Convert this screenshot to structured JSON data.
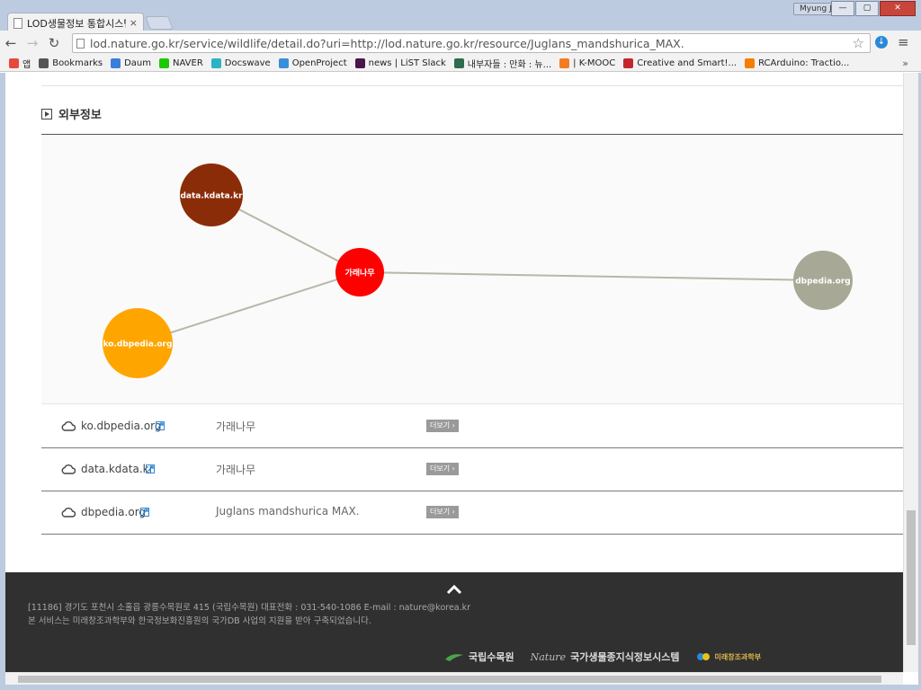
{
  "browser": {
    "tab_title": "LOD생물정보 통합시스템",
    "tab_close": "×",
    "user_name": "Myung Jin",
    "url": "lod.nature.go.kr/service/wildlife/detail.do?uri=http://lod.nature.go.kr/resource/Juglans_mandshurica_MAX.",
    "bookmarks": [
      {
        "label": "앱",
        "color": "#e54a3c"
      },
      {
        "label": "Bookmarks",
        "color": "#555555"
      },
      {
        "label": "Daum",
        "color": "#3b7ddd"
      },
      {
        "label": "NAVER",
        "color": "#1ec800"
      },
      {
        "label": "Docswave",
        "color": "#2bb3c4"
      },
      {
        "label": "OpenProject",
        "color": "#3a8ed8"
      },
      {
        "label": "news | LiST Slack",
        "color": "#4a154b"
      },
      {
        "label": "내부자들 : 만화 : 뉴...",
        "color": "#2e6b4f"
      },
      {
        "label": "| K-MOOC",
        "color": "#f47b20"
      },
      {
        "label": "Creative and Smart!...",
        "color": "#c4262e"
      },
      {
        "label": "RCArduino: Tractio...",
        "color": "#f57d00"
      }
    ],
    "bookmarks_more": "»"
  },
  "section": {
    "title": "외부정보"
  },
  "graph": {
    "center_node": {
      "label": "가래나무",
      "color": "#ff0000"
    },
    "nodes": [
      {
        "label": "data.kdata.kr",
        "color": "#8b2c08"
      },
      {
        "label": "ko.dbpedia.org",
        "color": "#ffa500"
      },
      {
        "label": "dbpedia.org",
        "color": "#a8a896"
      }
    ],
    "edge_color": "#b8b6a6"
  },
  "links": [
    {
      "source": "ko.dbpedia.org",
      "label": "가래나무",
      "more": "더보기 ›"
    },
    {
      "source": "data.kdata.kr",
      "label": "가래나무",
      "more": "더보기 ›"
    },
    {
      "source": "dbpedia.org",
      "label": "Juglans mandshurica MAX.",
      "more": "더보기 ›"
    }
  ],
  "footer": {
    "address": "[11186] 경기도 포천시 소홀읍 광릉수목원로 415 (국립수목원) 대표전화 : 031-540-1086 E-mail : nature@korea.kr",
    "note": "본 서비스는 미래창조과학부와 한국정보화진흥원의 국가DB 사업의 지원을 받아 구축되었습니다.",
    "logos": [
      "국립수목원",
      "국가생물종지식정보시스템",
      "미래창조과학부"
    ],
    "logo_nature_mark": "Nature"
  }
}
